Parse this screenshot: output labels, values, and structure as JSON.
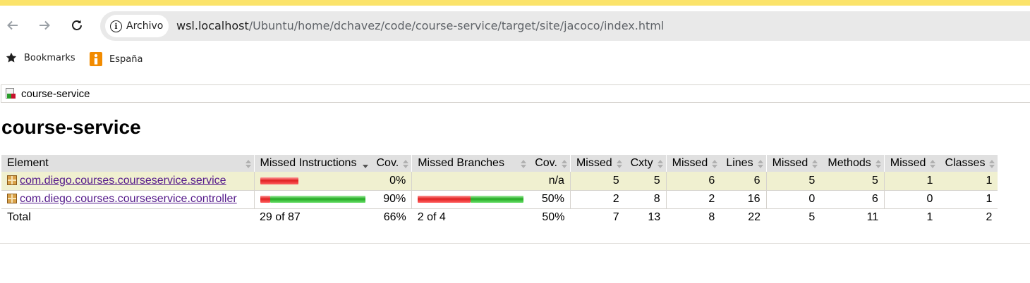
{
  "browser": {
    "security_chip": "Archivo",
    "url_host": "wsl.localhost",
    "url_path": "/Ubuntu/home/dchavez/code/course-service/target/site/jacoco/index.html",
    "accent_color": "#fbe36a"
  },
  "bookmarks_bar": {
    "items": [
      {
        "label": "Bookmarks",
        "icon": "star-icon"
      },
      {
        "label": "España",
        "icon": "info-brand-icon",
        "color": "#f28b00"
      }
    ]
  },
  "breadcrumb": {
    "label": "course-service"
  },
  "page": {
    "title": "course-service"
  },
  "table": {
    "headers": {
      "element": "Element",
      "missed_instructions": "Missed Instructions",
      "instr_cov": "Cov.",
      "missed_branches": "Missed Branches",
      "branch_cov": "Cov.",
      "cxty_missed": "Missed",
      "cxty": "Cxty",
      "lines_missed": "Missed",
      "lines": "Lines",
      "methods_missed": "Missed",
      "methods": "Methods",
      "classes_missed": "Missed",
      "classes": "Classes"
    },
    "rows": [
      {
        "element": "com.diego.courses.courseservice.service",
        "instr_missed_fraction": 1.0,
        "instr_cov": "0%",
        "branch_missed_fraction": null,
        "branch_cov": "n/a",
        "cxty_missed": "5",
        "cxty": "5",
        "lines_missed": "6",
        "lines": "6",
        "methods_missed": "5",
        "methods": "5",
        "classes_missed": "1",
        "classes": "1"
      },
      {
        "element": "com.diego.courses.courseservice.controller",
        "instr_missed_fraction": 0.1,
        "instr_cov": "90%",
        "branch_missed_fraction": 0.5,
        "branch_cov": "50%",
        "cxty_missed": "2",
        "cxty": "8",
        "lines_missed": "2",
        "lines": "16",
        "methods_missed": "0",
        "methods": "6",
        "classes_missed": "0",
        "classes": "1"
      }
    ],
    "total": {
      "label": "Total",
      "missed_instructions": "29 of 87",
      "instr_cov": "66%",
      "missed_branches": "2 of 4",
      "branch_cov": "50%",
      "cxty_missed": "7",
      "cxty": "13",
      "lines_missed": "8",
      "lines": "22",
      "methods_missed": "5",
      "methods": "11",
      "classes_missed": "1",
      "classes": "2"
    }
  }
}
